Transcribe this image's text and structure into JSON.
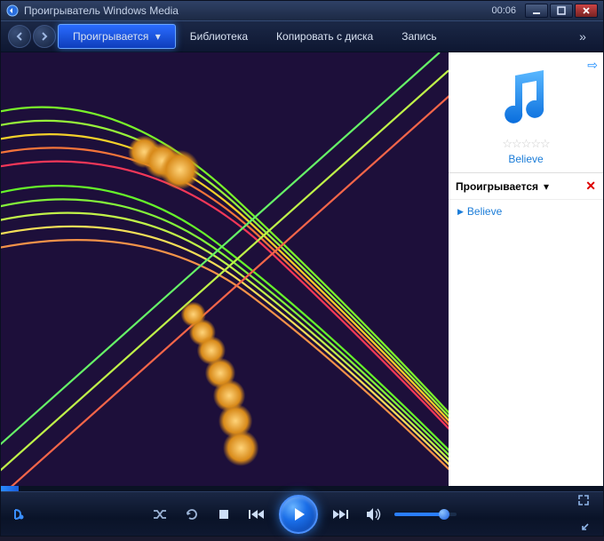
{
  "titlebar": {
    "app_name": "Проигрыватель Windows Media",
    "clock": "00:06"
  },
  "tabs": {
    "now_playing": "Проигрывается",
    "library": "Библиотека",
    "rip": "Копировать с диска",
    "burn": "Запись"
  },
  "sidebar": {
    "track_title": "Believe",
    "list_header": "Проигрывается",
    "items": [
      {
        "label": "Believe"
      }
    ]
  },
  "playback": {
    "progress_percent": 3,
    "volume_percent": 80
  },
  "colors": {
    "accent": "#1a7cd8",
    "play_glow": "#2a8cff"
  }
}
